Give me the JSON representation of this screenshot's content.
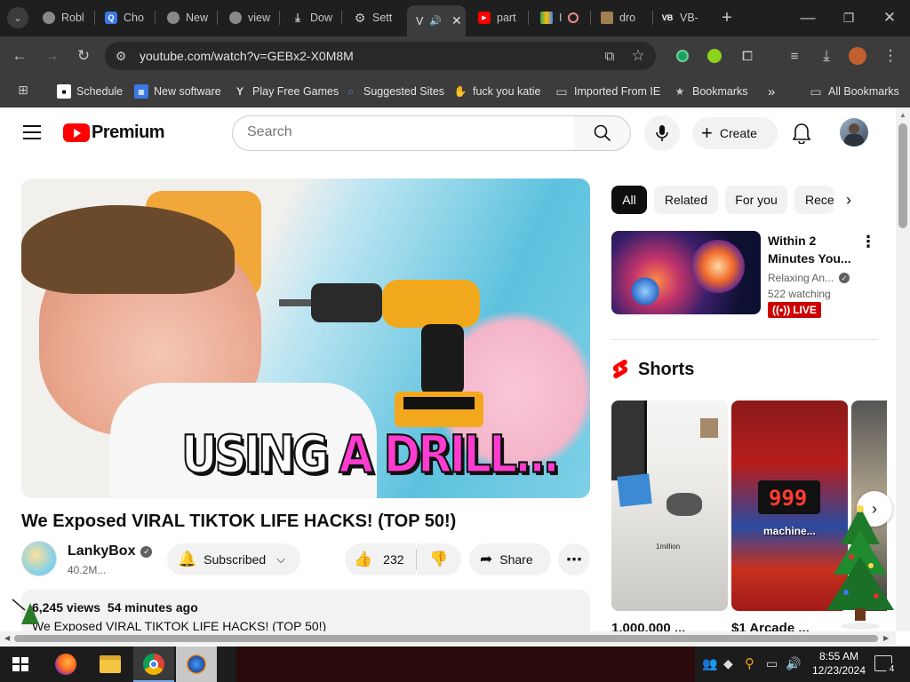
{
  "browser": {
    "tabs": [
      {
        "label": "Robl",
        "icon": "chrome-icon"
      },
      {
        "label": "Cho",
        "icon": "search-icon"
      },
      {
        "label": "New",
        "icon": "chrome-icon"
      },
      {
        "label": "view",
        "icon": "chrome-icon"
      },
      {
        "label": "Dow",
        "icon": "download-icon"
      },
      {
        "label": "Sett",
        "icon": "gear-icon"
      },
      {
        "label": "V",
        "icon": "audio-icon"
      },
      {
        "label": "part",
        "icon": "youtube-icon"
      },
      {
        "label": "I",
        "icon": "record-icon"
      },
      {
        "label": "dro",
        "icon": "folder-icon"
      },
      {
        "label": "VB-",
        "icon": "vb-icon"
      }
    ],
    "url": "youtube.com/watch?v=GEBx2-X0M8M",
    "bookmarks": [
      {
        "label": "Schedule"
      },
      {
        "label": "New software"
      },
      {
        "label": "Play Free Games"
      },
      {
        "label": "Suggested Sites"
      },
      {
        "label": "fuck you katie"
      },
      {
        "label": "Imported From IE"
      },
      {
        "label": "Bookmarks"
      }
    ],
    "all_bookmarks": "All Bookmarks",
    "more": "»"
  },
  "youtube": {
    "logo": "Premium",
    "search_placeholder": "Search",
    "create_label": "Create",
    "video": {
      "thumbnail_text_1": "USING ",
      "thumbnail_text_2": "A DRILL...",
      "title": "We Exposed VIRAL TIKTOK LIFE HACKS! (TOP 50!)",
      "channel": "LankyBox",
      "subscribers": "40.2M...",
      "subscribed_label": "Subscribed",
      "likes": "232",
      "share_label": "Share",
      "views": "6,245 views",
      "time_ago": "54 minutes ago",
      "description": "We Exposed VIRAL TIKTOK LIFE HACKS! (TOP 50!)"
    },
    "chips": [
      "All",
      "Related",
      "For you",
      "Rece"
    ],
    "recommended": {
      "title_line1": "Within 2",
      "title_line2": "Minutes You...",
      "channel": "Relaxing An...",
      "watching": "522 watching",
      "live_label": "LIVE"
    },
    "shorts": {
      "heading": "Shorts",
      "items": [
        {
          "title": "1,000,000 ...",
          "overlay": "1million"
        },
        {
          "title": "$1 Arcade ...",
          "overlay": "machine...",
          "display": "999"
        }
      ]
    }
  },
  "taskbar": {
    "time": "8:55 AM",
    "date": "12/23/2024",
    "notifications": "4"
  },
  "colors": {
    "youtube_red": "#ff0000",
    "chrome_dark": "#3c3c3c",
    "live_red": "#cc0000",
    "thumbnail_pink": "#ff3ccf"
  }
}
